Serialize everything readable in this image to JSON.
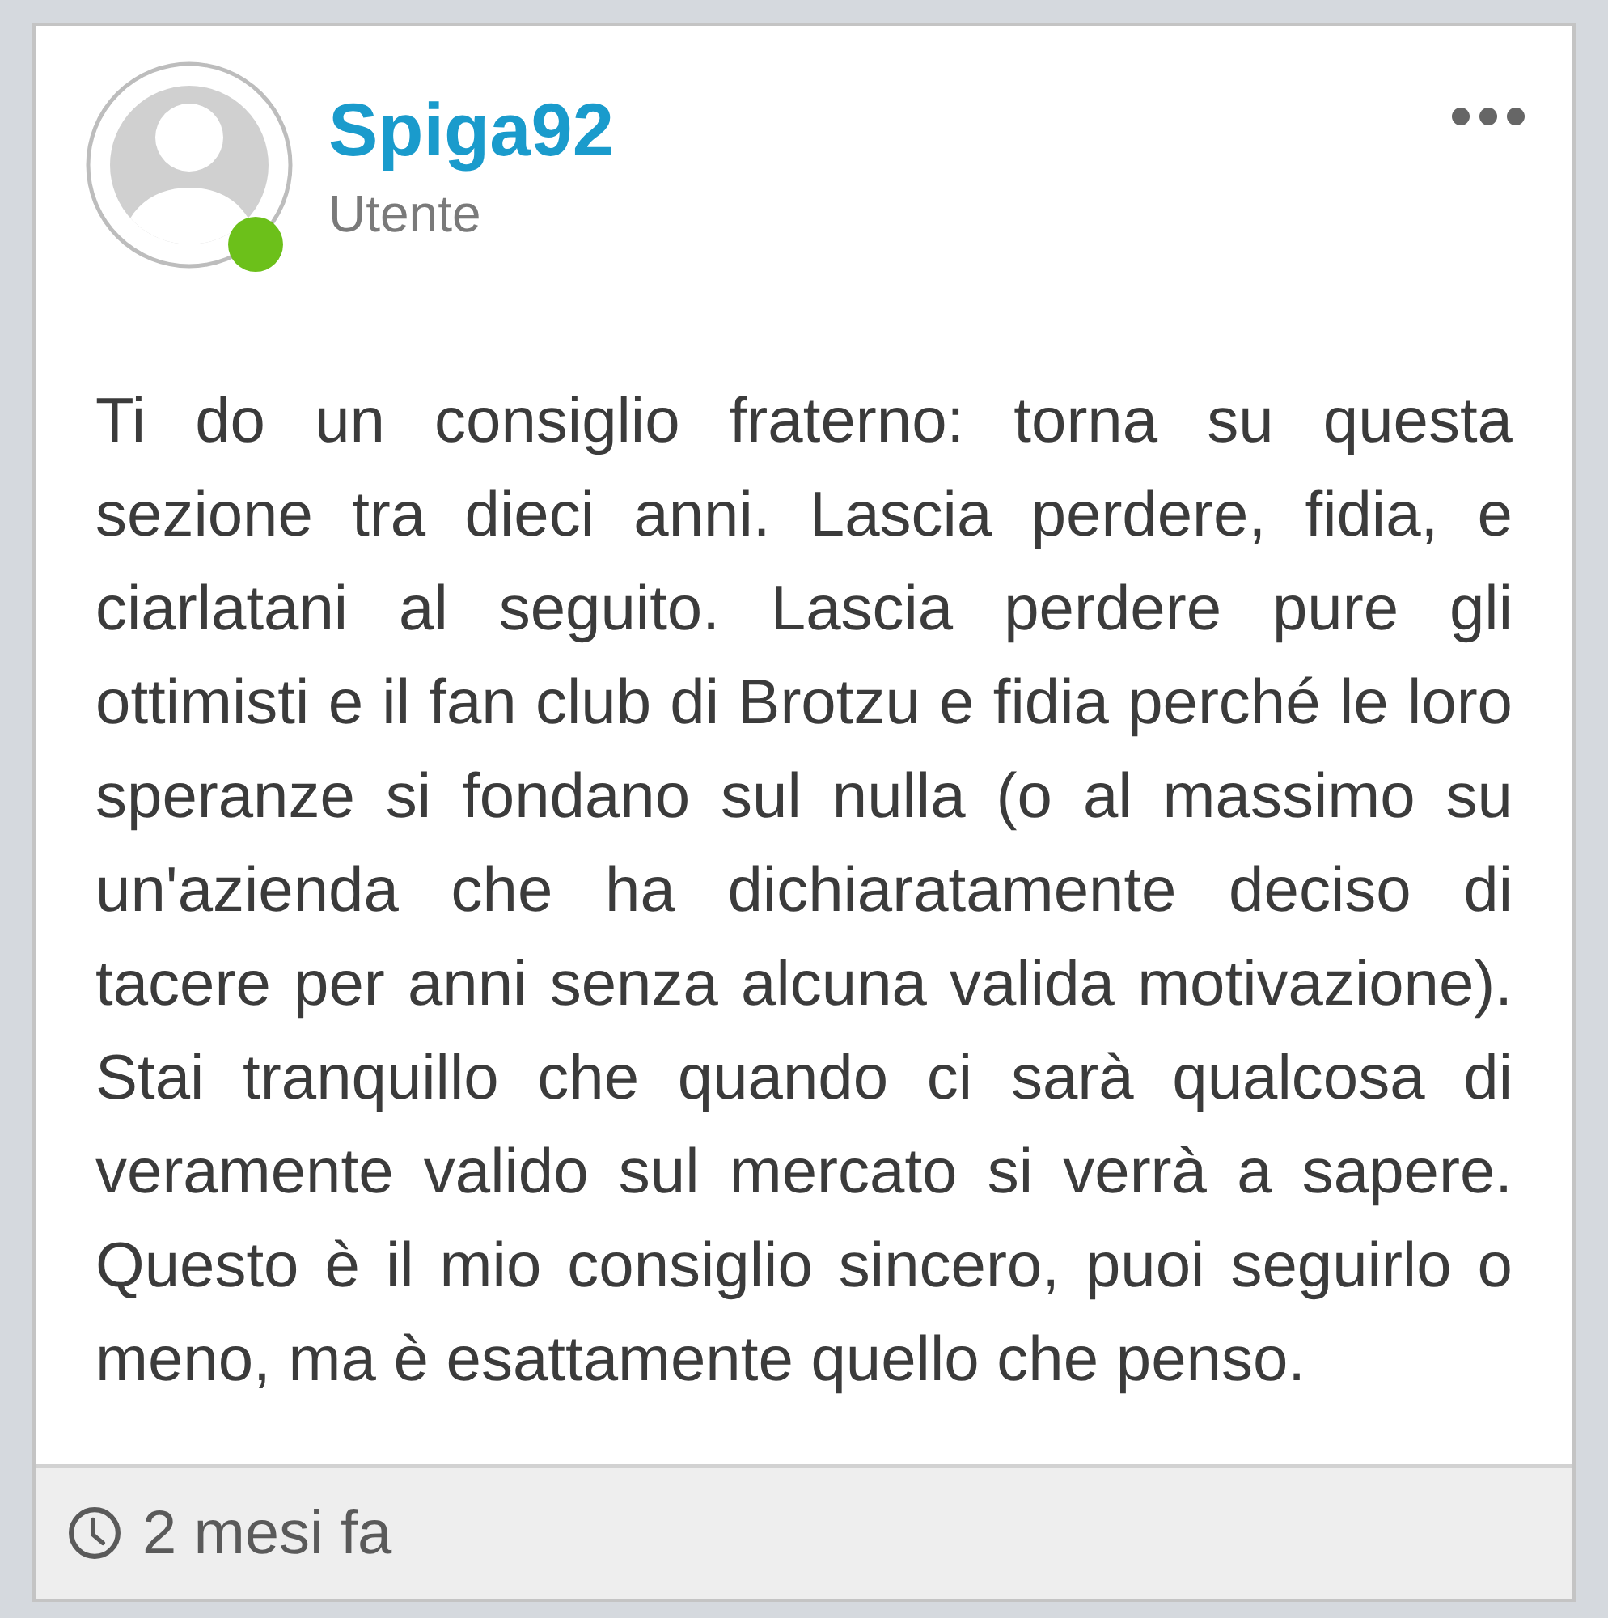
{
  "post": {
    "author": {
      "name": "Spiga92",
      "role": "Utente",
      "online": true
    },
    "body": "Ti do un consiglio fraterno: torna su questa sezione tra dieci anni. Lascia perdere, fidia, e ciarlatani al seguito. Lascia perdere pure gli ottimisti e il fan club di Brotzu e fidia perché le loro speranze si fondano sul nulla (o al massimo su un'azienda che ha dichiaratamente deciso di tacere per anni senza alcuna valida motivazione). Stai tranquillo che quando ci sarà qualcosa di veramente valido sul mercato si verrà a sapere. Questo è il mio consiglio sincero, puoi seguirlo o meno, ma è esattamente quello che penso.",
    "time": "2 mesi fa"
  }
}
